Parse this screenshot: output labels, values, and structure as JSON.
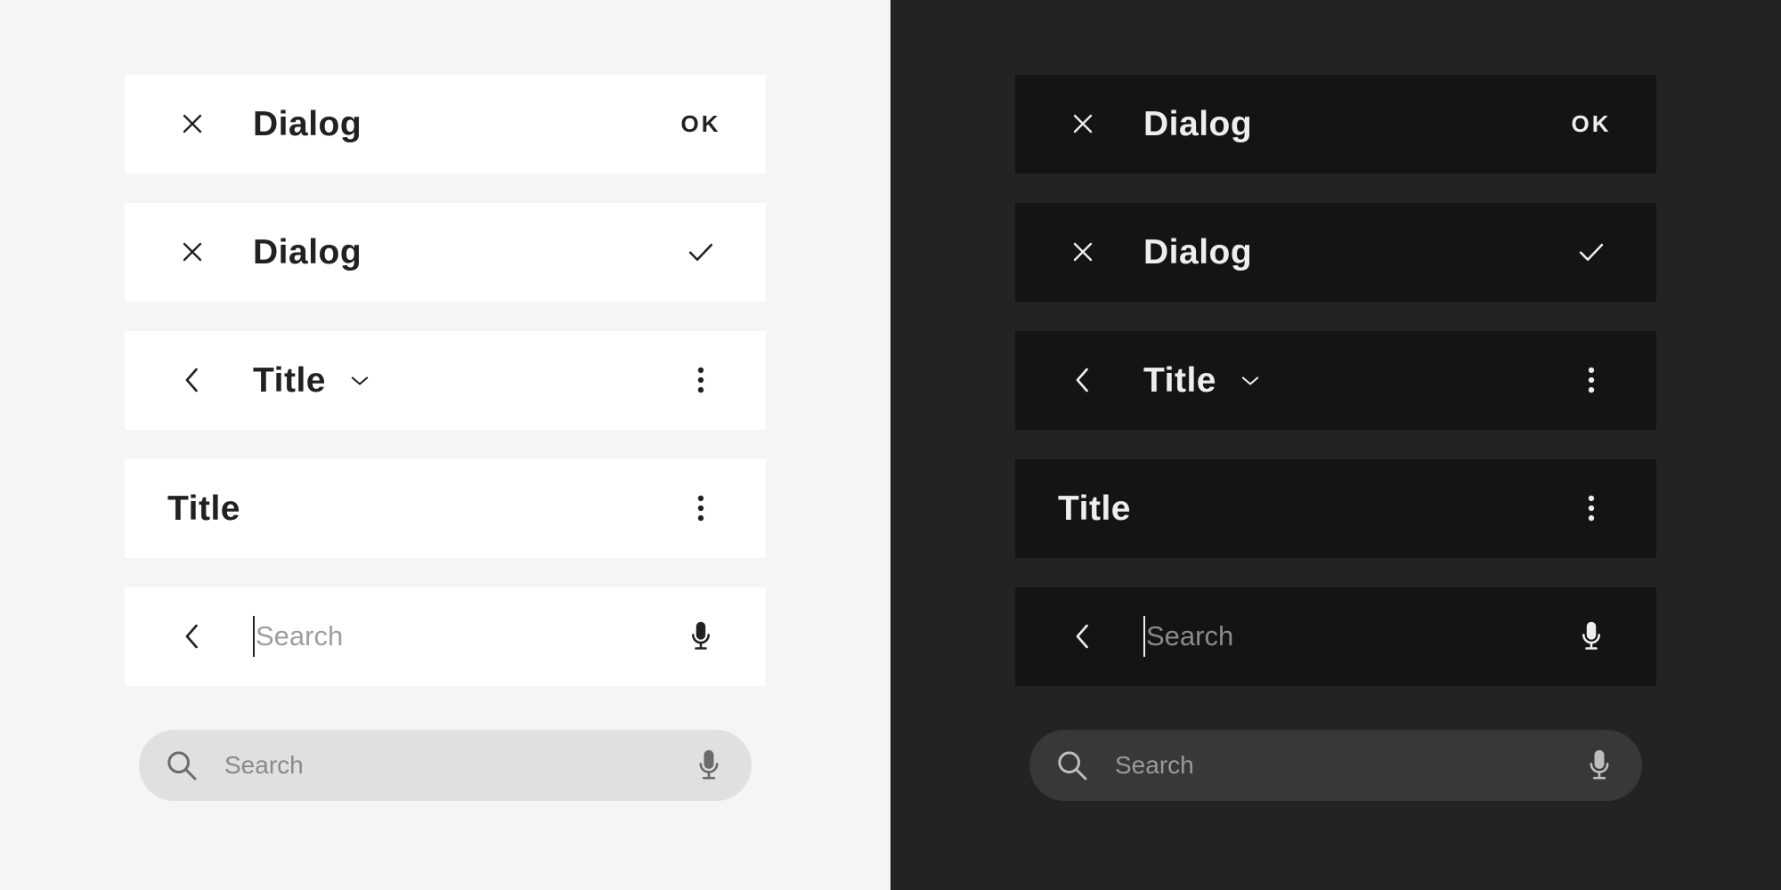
{
  "colors": {
    "light_background": "#f5f5f5",
    "light_bar": "#ffffff",
    "light_text": "#212121",
    "light_pill": "#e0e0e0",
    "dark_background": "#232323",
    "dark_bar": "#141414",
    "dark_text": "#eeeeee",
    "dark_pill": "#383838"
  },
  "light": {
    "bar1": {
      "lead_icon": "close-icon",
      "title": "Dialog",
      "action_label": "OK"
    },
    "bar2": {
      "lead_icon": "close-icon",
      "title": "Dialog",
      "action_icon": "check-icon"
    },
    "bar3": {
      "lead_icon": "chevron-left-icon",
      "title": "Title",
      "dropdown_icon": "chevron-down-icon",
      "action_icon": "more-vert-icon"
    },
    "bar4": {
      "title": "Title",
      "action_icon": "more-vert-icon"
    },
    "bar5": {
      "lead_icon": "chevron-left-icon",
      "placeholder": "Search",
      "action_icon": "mic-icon"
    },
    "pill": {
      "lead_icon": "search-icon",
      "placeholder": "Search",
      "action_icon": "mic-icon"
    }
  },
  "dark": {
    "bar1": {
      "lead_icon": "close-icon",
      "title": "Dialog",
      "action_label": "OK"
    },
    "bar2": {
      "lead_icon": "close-icon",
      "title": "Dialog",
      "action_icon": "check-icon"
    },
    "bar3": {
      "lead_icon": "chevron-left-icon",
      "title": "Title",
      "dropdown_icon": "chevron-down-icon",
      "action_icon": "more-vert-icon"
    },
    "bar4": {
      "title": "Title",
      "action_icon": "more-vert-icon"
    },
    "bar5": {
      "lead_icon": "chevron-left-icon",
      "placeholder": "Search",
      "action_icon": "mic-icon"
    },
    "pill": {
      "lead_icon": "search-icon",
      "placeholder": "Search",
      "action_icon": "mic-icon"
    }
  }
}
